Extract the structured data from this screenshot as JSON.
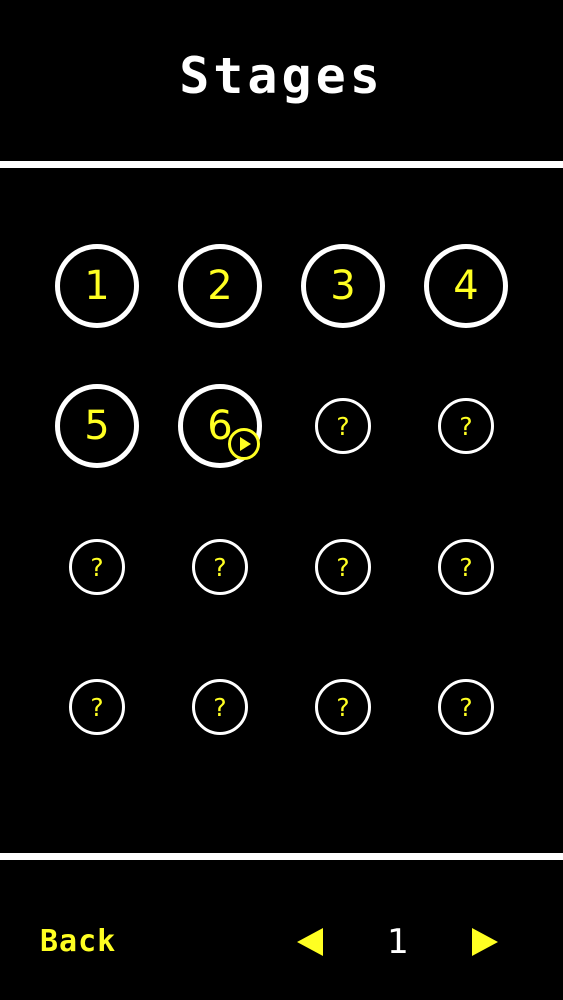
{
  "header": {
    "title": "Stages"
  },
  "stages": [
    {
      "label": "1",
      "state": "unlocked"
    },
    {
      "label": "2",
      "state": "unlocked"
    },
    {
      "label": "3",
      "state": "unlocked"
    },
    {
      "label": "4",
      "state": "unlocked"
    },
    {
      "label": "5",
      "state": "unlocked"
    },
    {
      "label": "6",
      "state": "current",
      "badge_icon": "play-icon"
    },
    {
      "label": "?",
      "state": "locked"
    },
    {
      "label": "?",
      "state": "locked"
    },
    {
      "label": "?",
      "state": "locked"
    },
    {
      "label": "?",
      "state": "locked"
    },
    {
      "label": "?",
      "state": "locked"
    },
    {
      "label": "?",
      "state": "locked"
    },
    {
      "label": "?",
      "state": "locked"
    },
    {
      "label": "?",
      "state": "locked"
    },
    {
      "label": "?",
      "state": "locked"
    },
    {
      "label": "?",
      "state": "locked"
    }
  ],
  "footer": {
    "back_label": "Back",
    "page": "1",
    "prev_icon": "arrow-left-icon",
    "next_icon": "arrow-right-icon"
  },
  "colors": {
    "background": "#000000",
    "accent": "#ffff22",
    "ring": "#ffffff"
  }
}
